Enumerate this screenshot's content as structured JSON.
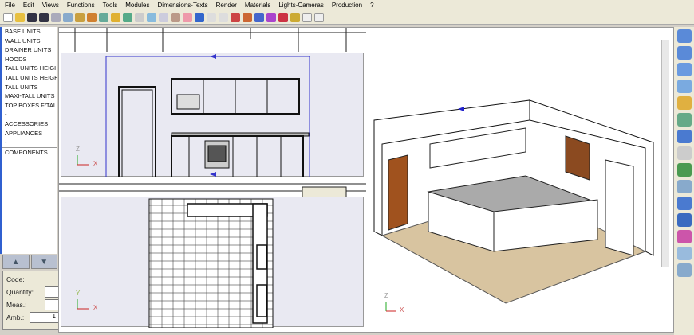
{
  "menu": [
    "File",
    "Edit",
    "Views",
    "Functions",
    "Tools",
    "Modules",
    "Dimensions-Texts",
    "Render",
    "Materials",
    "Lights-Cameras",
    "Production",
    "?"
  ],
  "sidebar": {
    "items": [
      "BASE UNITS",
      "WALL UNITS",
      "DRAINER UNITS",
      "HOODS",
      "TALL UNITS HEIGH",
      "TALL UNITS HEIGH",
      "TALL UNITS",
      "MAXI-TALL UNITS",
      "TOP BOXES F/TAL",
      "-",
      "ACCESSORIES",
      "APPLIANCES",
      "-",
      "COMPONENTS"
    ]
  },
  "nav": {
    "up_icon": "arrow-up-icon",
    "down_icon": "arrow-down-icon"
  },
  "properties": {
    "code_label": "Code:",
    "quantity_label": "Quantity:",
    "quantity_value": "",
    "meas_label": "Meas.:",
    "meas_value": "",
    "amb_label": "Amb.:",
    "amb_value": "1"
  },
  "axes": {
    "z": "Z",
    "x": "X",
    "y": "Y"
  },
  "colors": {
    "sidebar_accent": "#3060d0",
    "door": "#a0521e",
    "floor": "#d8c4a0"
  }
}
